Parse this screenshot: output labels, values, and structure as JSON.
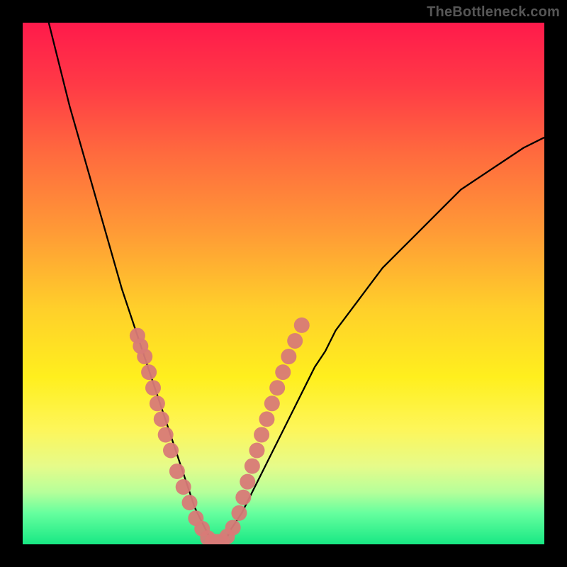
{
  "watermark": "TheBottleneck.com",
  "gradient": {
    "stops": [
      {
        "offset": 0.0,
        "color": "#ff1a4b"
      },
      {
        "offset": 0.12,
        "color": "#ff3a46"
      },
      {
        "offset": 0.25,
        "color": "#ff6a3e"
      },
      {
        "offset": 0.4,
        "color": "#ff9a36"
      },
      {
        "offset": 0.55,
        "color": "#ffd02a"
      },
      {
        "offset": 0.68,
        "color": "#ffef1e"
      },
      {
        "offset": 0.78,
        "color": "#fdf65a"
      },
      {
        "offset": 0.85,
        "color": "#e6fb8a"
      },
      {
        "offset": 0.9,
        "color": "#b6ff9a"
      },
      {
        "offset": 0.94,
        "color": "#66ff9e"
      },
      {
        "offset": 1.0,
        "color": "#18e884"
      }
    ]
  },
  "chart_data": {
    "type": "line",
    "title": "",
    "xlabel": "",
    "ylabel": "",
    "xlim": [
      0,
      100
    ],
    "ylim": [
      0,
      100
    ],
    "grid": false,
    "legend": false,
    "x": [
      5,
      7,
      9,
      11,
      13,
      15,
      17,
      19,
      21,
      22,
      23,
      24,
      25,
      26,
      27,
      28,
      29,
      30,
      31,
      32,
      33,
      34,
      35,
      36,
      37,
      38,
      39,
      40,
      42,
      44,
      46,
      48,
      50,
      52,
      54,
      56,
      58,
      60,
      63,
      66,
      69,
      72,
      75,
      78,
      81,
      84,
      87,
      90,
      93,
      96,
      100
    ],
    "values": [
      100,
      92,
      84,
      77,
      70,
      63,
      56,
      49,
      43,
      40,
      37,
      34,
      31,
      28,
      25,
      22,
      19,
      16,
      13,
      10,
      7,
      5,
      3,
      1,
      0,
      0,
      1,
      3,
      6,
      10,
      14,
      18,
      22,
      26,
      30,
      34,
      37,
      41,
      45,
      49,
      53,
      56,
      59,
      62,
      65,
      68,
      70,
      72,
      74,
      76,
      78
    ],
    "marker_groups": [
      {
        "name": "left-branch-markers",
        "color": "#d87a77",
        "points": [
          {
            "x": 22.0,
            "y": 40
          },
          {
            "x": 22.6,
            "y": 38
          },
          {
            "x": 23.4,
            "y": 36
          },
          {
            "x": 24.2,
            "y": 33
          },
          {
            "x": 25.0,
            "y": 30
          },
          {
            "x": 25.8,
            "y": 27
          },
          {
            "x": 26.6,
            "y": 24
          },
          {
            "x": 27.4,
            "y": 21
          },
          {
            "x": 28.4,
            "y": 18
          },
          {
            "x": 29.6,
            "y": 14
          },
          {
            "x": 30.8,
            "y": 11
          },
          {
            "x": 32.0,
            "y": 8
          },
          {
            "x": 33.2,
            "y": 5
          },
          {
            "x": 34.4,
            "y": 3
          }
        ]
      },
      {
        "name": "bottom-markers",
        "color": "#d87a77",
        "points": [
          {
            "x": 35.5,
            "y": 1.2
          },
          {
            "x": 36.4,
            "y": 0.6
          },
          {
            "x": 37.3,
            "y": 0.5
          },
          {
            "x": 38.2,
            "y": 0.6
          },
          {
            "x": 39.2,
            "y": 1.5
          },
          {
            "x": 40.3,
            "y": 3.2
          }
        ]
      },
      {
        "name": "right-branch-markers",
        "color": "#d87a77",
        "points": [
          {
            "x": 41.5,
            "y": 6
          },
          {
            "x": 42.3,
            "y": 9
          },
          {
            "x": 43.1,
            "y": 12
          },
          {
            "x": 44.0,
            "y": 15
          },
          {
            "x": 44.9,
            "y": 18
          },
          {
            "x": 45.8,
            "y": 21
          },
          {
            "x": 46.8,
            "y": 24
          },
          {
            "x": 47.8,
            "y": 27
          },
          {
            "x": 48.8,
            "y": 30
          },
          {
            "x": 49.9,
            "y": 33
          },
          {
            "x": 51.0,
            "y": 36
          },
          {
            "x": 52.2,
            "y": 39
          },
          {
            "x": 53.5,
            "y": 42
          }
        ]
      }
    ]
  }
}
